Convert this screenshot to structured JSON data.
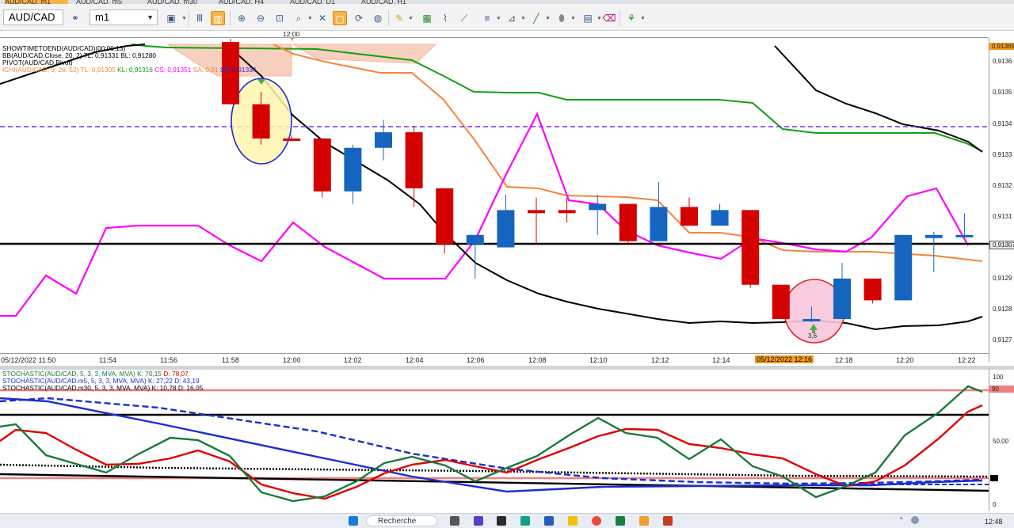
{
  "tabs": [
    "AUD/CAD, m1",
    "AUD/CAD, m5",
    "AUD/CAD, m30",
    "AUD/CAD, H4",
    "AUD/CAD, D1",
    "AUD/CAD, H1"
  ],
  "toolbar": {
    "symbol": "AUD/CAD",
    "timeframe": "m1"
  },
  "top_axis_label": "12:00",
  "legends": {
    "showtime": "SHOWTIMETOEND(AUD/CAD)(00:00:13)",
    "bb": "BB(AUD/CAD,Close, 20, 2)  TL: 0,91331  BL: 0,91280",
    "pivot": "PIVOT(AUD/CAD,Pivot)",
    "ichi_name": "ICHI(AUD/CAD, 9, 26, 52)",
    "ichi_tl": "TL: 0,91305",
    "ichi_kl": "KL: 0,91316",
    "ichi_cs": "CS: 0,91351",
    "ichi_sa": "SA: 0,91",
    "ichi_sb": "SB: 0,91334"
  },
  "price_axis": {
    "labels": [
      "0,9136",
      "0,9135",
      "0,9134",
      "0,9133",
      "0,9132",
      "0,9131",
      "0,9130",
      "0,9129",
      "0,9128",
      "0,9127"
    ],
    "top_tag": "0,91369",
    "current_tag": "0,91307"
  },
  "x_axis": {
    "labels": [
      "05/12/2022 11:50",
      "11:54",
      "11:56",
      "11:58",
      "12:00",
      "12:02",
      "12:04",
      "12:06",
      "12:08",
      "12:10",
      "12:12",
      "12:14",
      "05/12/2022 12:16",
      "12:18",
      "12:20",
      "12:22"
    ]
  },
  "marker_value": "3,6",
  "stoch_legends": [
    {
      "name": "STOCHASTIC(AUD/CAD, 5, 3, 3, MVA, MVA)",
      "k": "K: 70,15",
      "d": "D: 78,07"
    },
    {
      "name": "STOCHASTIC(AUD/CAD.m5, 5, 3, 3, MVA, MVA)",
      "k": "K: 27,22",
      "d": "D: 43,19"
    },
    {
      "name": "STOCHASTIC(AUD/CAD.m30, 5, 3, 3, MVA, MVA)",
      "k": "K: 10,78",
      "d": "D: 16,05"
    }
  ],
  "stoch_axis": {
    "top": "100",
    "tag": "90",
    "mid": "50,00",
    "bottom": "0"
  },
  "taskbar": {
    "search": "Recherche",
    "time": "12:48"
  },
  "colors": {
    "bull": "#1565c0",
    "bear": "#d50000",
    "magenta": "#ff00ff",
    "orange": "#f5843c",
    "green": "#11a011",
    "pivot_line": "#7a2ff0",
    "accent": "#f7b24a"
  },
  "chart_data": {
    "type": "candlestick",
    "ylim": [
      0.91265,
      0.91367
    ],
    "x": [
      "11:58",
      "11:59",
      "12:00",
      "12:01",
      "12:02",
      "12:03",
      "12:04",
      "12:05",
      "12:06",
      "12:07",
      "12:08",
      "12:09",
      "12:10",
      "12:11",
      "12:12",
      "12:13",
      "12:14",
      "12:15",
      "12:16",
      "12:17",
      "12:18",
      "12:19",
      "12:20",
      "12:21",
      "12:22"
    ],
    "candles": [
      {
        "o": 0.91368,
        "h": 0.91369,
        "l": 0.91348,
        "c": 0.91348
      },
      {
        "o": 0.91348,
        "h": 0.91352,
        "l": 0.91335,
        "c": 0.91337
      },
      {
        "o": 0.91337,
        "h": 0.91338,
        "l": 0.91336,
        "c": 0.91337
      },
      {
        "o": 0.91337,
        "h": 0.91337,
        "l": 0.91318,
        "c": 0.9132
      },
      {
        "o": 0.9132,
        "h": 0.91335,
        "l": 0.91316,
        "c": 0.91334
      },
      {
        "o": 0.91334,
        "h": 0.91343,
        "l": 0.9133,
        "c": 0.91339
      },
      {
        "o": 0.91339,
        "h": 0.91341,
        "l": 0.91315,
        "c": 0.91321
      },
      {
        "o": 0.91321,
        "h": 0.91321,
        "l": 0.913,
        "c": 0.91303
      },
      {
        "o": 0.91303,
        "h": 0.91303,
        "l": 0.91292,
        "c": 0.91306
      },
      {
        "o": 0.91302,
        "h": 0.91319,
        "l": 0.91302,
        "c": 0.91314
      },
      {
        "o": 0.91314,
        "h": 0.91318,
        "l": 0.91303,
        "c": 0.91313
      },
      {
        "o": 0.91313,
        "h": 0.91318,
        "l": 0.9131,
        "c": 0.91314
      },
      {
        "o": 0.91314,
        "h": 0.91319,
        "l": 0.91306,
        "c": 0.91316
      },
      {
        "o": 0.91316,
        "h": 0.91316,
        "l": 0.91303,
        "c": 0.91304
      },
      {
        "o": 0.91304,
        "h": 0.91323,
        "l": 0.91304,
        "c": 0.91315
      },
      {
        "o": 0.91315,
        "h": 0.91318,
        "l": 0.91309,
        "c": 0.91309
      },
      {
        "o": 0.91309,
        "h": 0.91316,
        "l": 0.91309,
        "c": 0.91314
      },
      {
        "o": 0.91314,
        "h": 0.91314,
        "l": 0.91289,
        "c": 0.9129
      },
      {
        "o": 0.9129,
        "h": 0.9129,
        "l": 0.91279,
        "c": 0.91279
      },
      {
        "o": 0.91279,
        "h": 0.91283,
        "l": 0.91278,
        "c": 0.91279
      },
      {
        "o": 0.91279,
        "h": 0.91297,
        "l": 0.91279,
        "c": 0.91292
      },
      {
        "o": 0.91292,
        "h": 0.91292,
        "l": 0.91284,
        "c": 0.91285
      },
      {
        "o": 0.91285,
        "h": 0.91306,
        "l": 0.91285,
        "c": 0.91306
      },
      {
        "o": 0.91305,
        "h": 0.91307,
        "l": 0.91294,
        "c": 0.91306
      },
      {
        "o": 0.91306,
        "h": 0.91313,
        "l": 0.91305,
        "c": 0.91306
      }
    ]
  }
}
